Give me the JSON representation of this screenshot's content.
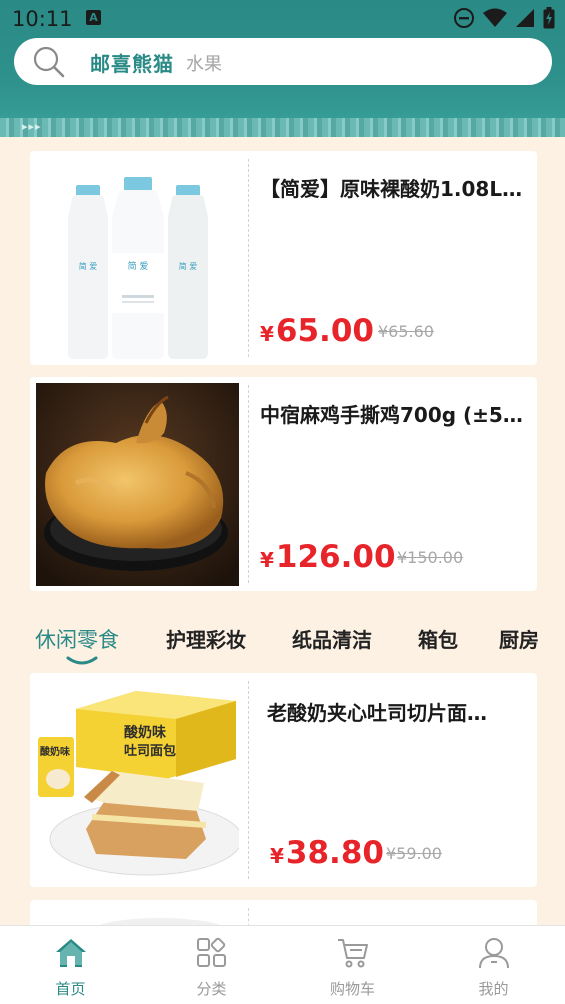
{
  "status_bar": {
    "time": "10:11",
    "notification_icon": "A"
  },
  "search": {
    "brand": "邮喜熊猫",
    "placeholder": "水果"
  },
  "header_banner": {
    "arrows": "▸▸▸"
  },
  "products_top": [
    {
      "title": "【简爱】原味裸酸奶1.08L…",
      "price": "65.00",
      "original_price": "¥65.60",
      "image_icon": "yogurt-bottles"
    },
    {
      "title": "中宿麻鸡手撕鸡700g (±5…",
      "price": "126.00",
      "original_price": "¥150.00",
      "image_icon": "roast-chicken"
    }
  ],
  "currency_symbol": "¥",
  "category_tabs": [
    {
      "label": "休闲零食",
      "active": true
    },
    {
      "label": "护理彩妆",
      "active": false
    },
    {
      "label": "纸品清洁",
      "active": false
    },
    {
      "label": "箱包",
      "active": false
    },
    {
      "label": "厨房",
      "active": false
    }
  ],
  "products_bottom": [
    {
      "title": "老酸奶夹心吐司切片面…",
      "price": "38.80",
      "original_price": "¥59.00",
      "image_icon": "yogurt-toast-bread"
    }
  ],
  "bottom_nav": [
    {
      "label": "首页",
      "icon": "home-icon",
      "active": true
    },
    {
      "label": "分类",
      "icon": "category-icon",
      "active": false
    },
    {
      "label": "购物车",
      "icon": "cart-icon",
      "active": false
    },
    {
      "label": "我的",
      "icon": "user-icon",
      "active": false
    }
  ],
  "colors": {
    "accent": "#2a8a86",
    "price": "#e8242b",
    "background": "#fdf1e4"
  }
}
